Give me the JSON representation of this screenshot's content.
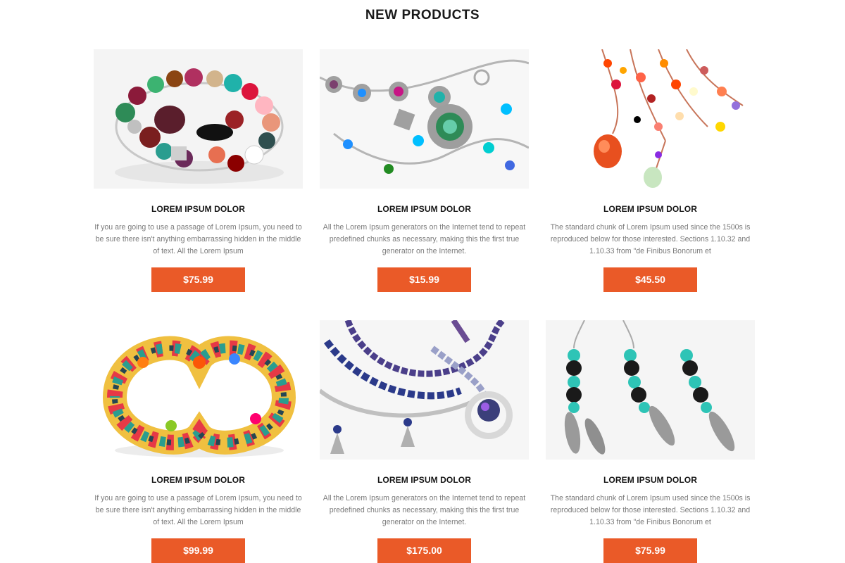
{
  "section_title": "NEW PRODUCTS",
  "products": [
    {
      "name": "LOREM IPSUM DOLOR",
      "description": "If you are going to use a passage of Lorem Ipsum, you need to be sure there isn't anything embarrassing hidden in the middle of text. All the Lorem Ipsum",
      "price": "$75.99",
      "image": "beaded-bracelet-image"
    },
    {
      "name": "LOREM IPSUM DOLOR",
      "description": "All the Lorem Ipsum generators on the Internet tend to repeat predefined chunks as necessary, making this the first true generator on the Internet.",
      "price": "$15.99",
      "image": "silver-necklace-image"
    },
    {
      "name": "LOREM IPSUM DOLOR",
      "description": "The standard chunk of Lorem Ipsum used since the 1500s is reproduced below for those interested. Sections 1.10.32 and 1.10.33 from \"de Finibus Bonorum et",
      "price": "$45.50",
      "image": "red-pendant-necklace-image"
    },
    {
      "name": "LOREM IPSUM DOLOR",
      "description": "If you are going to use a passage of Lorem Ipsum, you need to be sure there isn't anything embarrassing hidden in the middle of text. All the Lorem Ipsum",
      "price": "$99.99",
      "image": "colorful-seed-bead-bracelet-image"
    },
    {
      "name": "LOREM IPSUM DOLOR",
      "description": "All the Lorem Ipsum generators on the Internet tend to repeat predefined chunks as necessary, making this the first true generator on the Internet.",
      "price": "$175.00",
      "image": "blue-pearl-necklace-image"
    },
    {
      "name": "LOREM IPSUM DOLOR",
      "description": "The standard chunk of Lorem Ipsum used since the 1500s is reproduced below for those interested. Sections 1.10.32 and 1.10.33 from \"de Finibus Bonorum et",
      "price": "$75.99",
      "image": "feather-earrings-image"
    }
  ],
  "colors": {
    "accent": "#ea5a28",
    "title": "#1a1a1a",
    "description": "#7b7b7b"
  }
}
